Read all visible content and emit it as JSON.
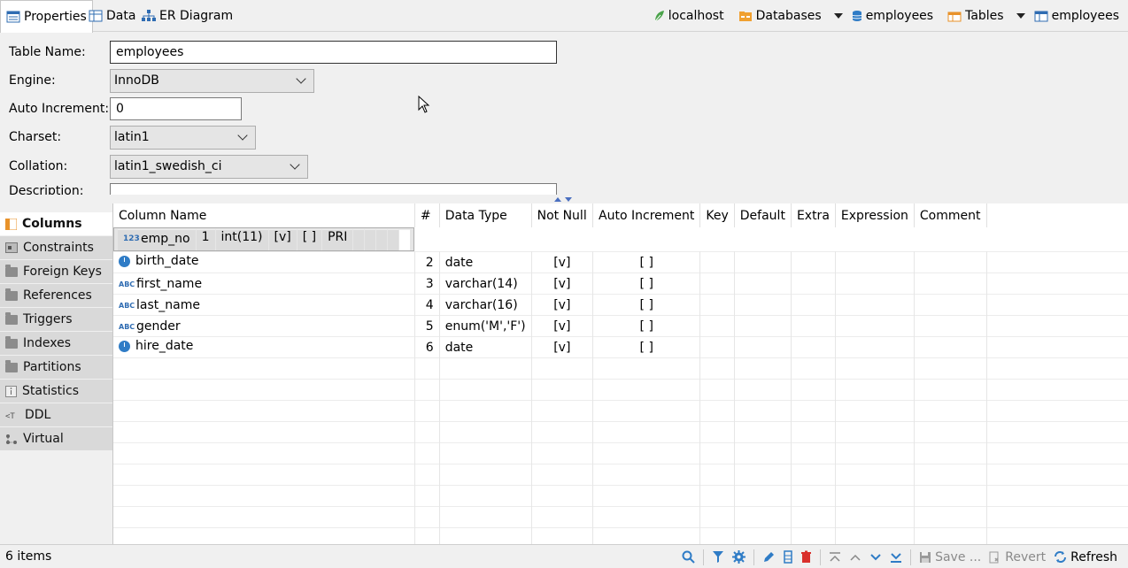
{
  "tabs": [
    {
      "label": "Properties",
      "icon": "properties-icon"
    },
    {
      "label": "Data",
      "icon": "data-icon"
    },
    {
      "label": "ER Diagram",
      "icon": "er-diagram-icon"
    }
  ],
  "breadcrumbs": [
    "localhost",
    "Databases",
    "employees",
    "Tables",
    "employees"
  ],
  "form": {
    "table_name_label": "Table Name:",
    "table_name_value": "employees",
    "engine_label": "Engine:",
    "engine_value": "InnoDB",
    "auto_increment_label": "Auto Increment:",
    "auto_increment_value": "0",
    "charset_label": "Charset:",
    "charset_value": "latin1",
    "collation_label": "Collation:",
    "collation_value": "latin1_swedish_ci",
    "description_label": "Description:"
  },
  "side_tabs": [
    "Columns",
    "Constraints",
    "Foreign Keys",
    "References",
    "Triggers",
    "Indexes",
    "Partitions",
    "Statistics",
    "DDL",
    "Virtual"
  ],
  "grid": {
    "headers": [
      "Column Name",
      "#",
      "Data Type",
      "Not Null",
      "Auto Increment",
      "Key",
      "Default",
      "Extra",
      "Expression",
      "Comment"
    ],
    "rows": [
      {
        "name": "emp_no",
        "type_icon": "numeric-icon",
        "num": "1",
        "data_type": "int(11)",
        "not_null": "[v]",
        "auto_inc": "[ ]",
        "key": "PRI",
        "default": "",
        "extra": "",
        "expression": "",
        "comment": ""
      },
      {
        "name": "birth_date",
        "type_icon": "date-icon",
        "num": "2",
        "data_type": "date",
        "not_null": "[v]",
        "auto_inc": "[ ]",
        "key": "",
        "default": "",
        "extra": "",
        "expression": "",
        "comment": ""
      },
      {
        "name": "first_name",
        "type_icon": "string-icon",
        "num": "3",
        "data_type": "varchar(14)",
        "not_null": "[v]",
        "auto_inc": "[ ]",
        "key": "",
        "default": "",
        "extra": "",
        "expression": "",
        "comment": ""
      },
      {
        "name": "last_name",
        "type_icon": "string-icon",
        "num": "4",
        "data_type": "varchar(16)",
        "not_null": "[v]",
        "auto_inc": "[ ]",
        "key": "",
        "default": "",
        "extra": "",
        "expression": "",
        "comment": ""
      },
      {
        "name": "gender",
        "type_icon": "string-icon",
        "num": "5",
        "data_type": "enum('M','F')",
        "not_null": "[v]",
        "auto_inc": "[ ]",
        "key": "",
        "default": "",
        "extra": "",
        "expression": "",
        "comment": ""
      },
      {
        "name": "hire_date",
        "type_icon": "date-icon",
        "num": "6",
        "data_type": "date",
        "not_null": "[v]",
        "auto_inc": "[ ]",
        "key": "",
        "default": "",
        "extra": "",
        "expression": "",
        "comment": ""
      }
    ]
  },
  "status": {
    "count": "6 items",
    "save_label": "Save ...",
    "revert_label": "Revert",
    "refresh_label": "Refresh"
  },
  "colors": {
    "accent": "#2f7cc6",
    "selected_row": "#dcdcdc",
    "delete": "#d9302c"
  }
}
